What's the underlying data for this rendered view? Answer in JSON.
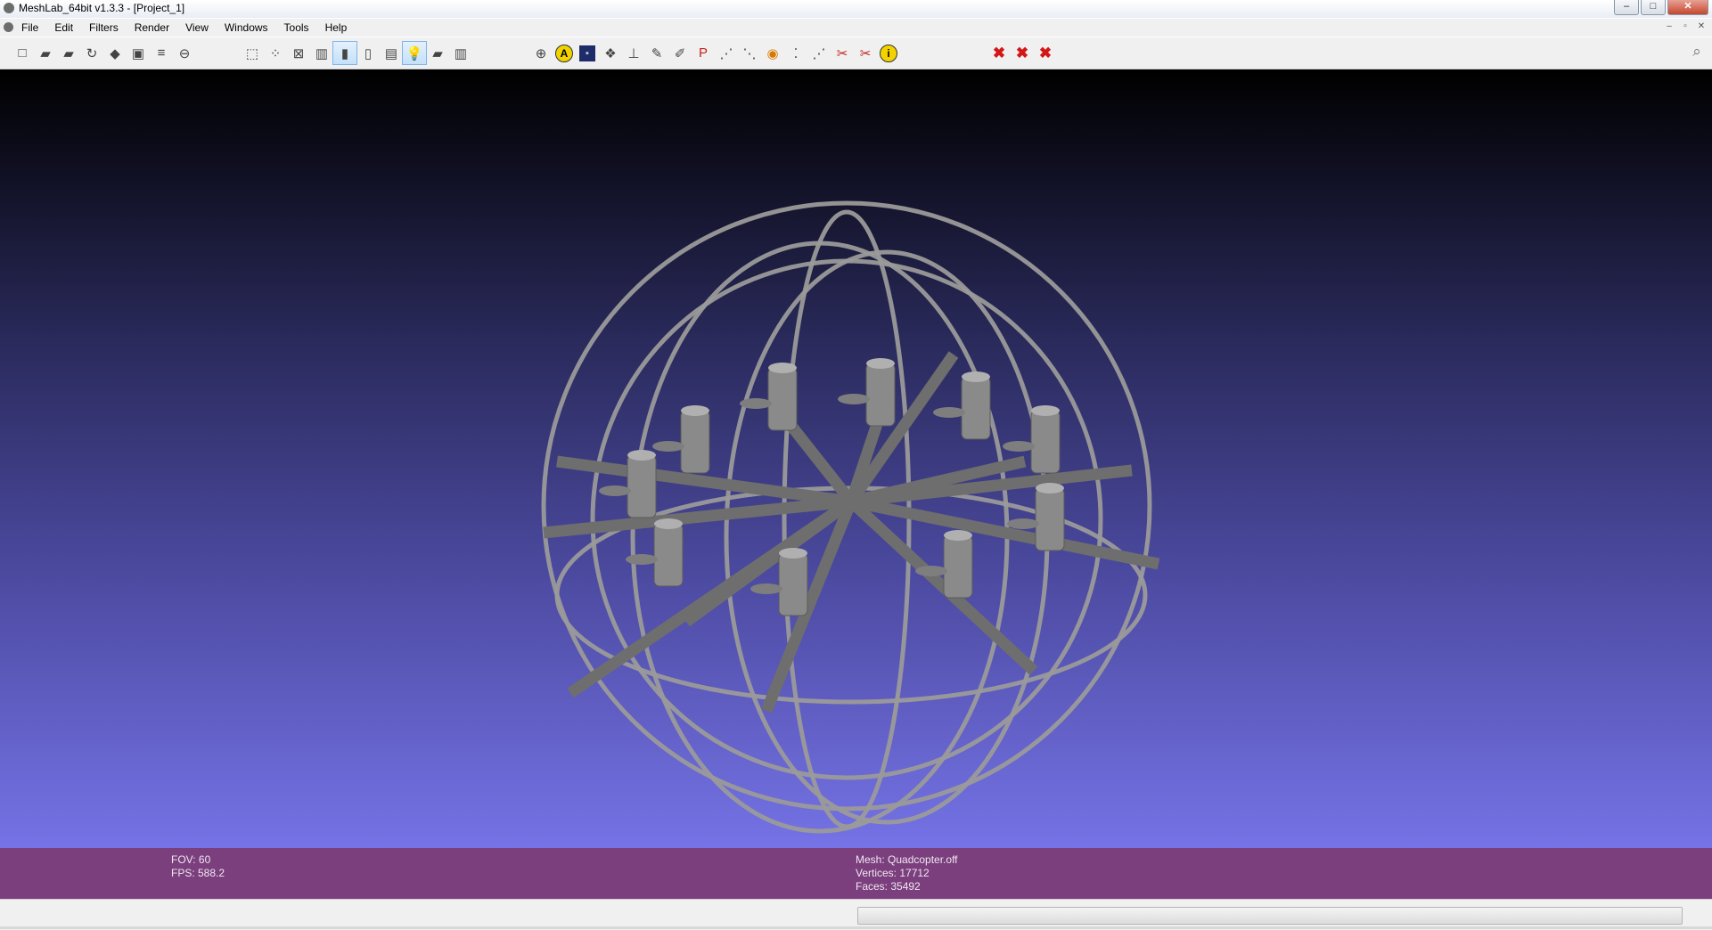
{
  "window": {
    "title": "MeshLab_64bit v1.3.3 - [Project_1]",
    "controls": {
      "minimize": "–",
      "maximize": "□",
      "close": "✕"
    }
  },
  "menu": {
    "items": [
      "File",
      "Edit",
      "Filters",
      "Render",
      "View",
      "Windows",
      "Tools",
      "Help"
    ],
    "mdi_controls": {
      "minimize": "–",
      "restore": "▫",
      "close": "✕"
    }
  },
  "toolbar": {
    "file_group": [
      {
        "name": "new-project",
        "icon": "□"
      },
      {
        "name": "open-project",
        "icon": "▰"
      },
      {
        "name": "import-mesh",
        "icon": "▰"
      },
      {
        "name": "reload",
        "icon": "↻"
      },
      {
        "name": "export-mesh",
        "icon": "◆"
      },
      {
        "name": "snapshot",
        "icon": "▣"
      },
      {
        "name": "layers",
        "icon": "≡"
      },
      {
        "name": "print",
        "icon": "⊖"
      }
    ],
    "render_group": [
      {
        "name": "bounding-box",
        "icon": "⬚",
        "active": false
      },
      {
        "name": "points",
        "icon": "⁘",
        "active": false
      },
      {
        "name": "wireframe",
        "icon": "⊠",
        "active": false
      },
      {
        "name": "flat-lines",
        "icon": "▥",
        "active": false
      },
      {
        "name": "flat",
        "icon": "▮",
        "active": true
      },
      {
        "name": "smooth",
        "icon": "▯",
        "active": false
      },
      {
        "name": "texture",
        "icon": "▤",
        "active": false
      },
      {
        "name": "light",
        "icon": "💡",
        "active": true
      },
      {
        "name": "double-side",
        "icon": "▰",
        "active": false
      },
      {
        "name": "fancy",
        "icon": "▥",
        "active": false
      }
    ],
    "edit_group": [
      {
        "name": "manipulator",
        "icon": "⊕"
      },
      {
        "name": "annotate",
        "icon": "A",
        "style": "y"
      },
      {
        "name": "measure",
        "icon": "▪",
        "style": "dk"
      },
      {
        "name": "texture-param",
        "icon": "❖"
      },
      {
        "name": "align",
        "icon": "⊥"
      },
      {
        "name": "paint",
        "icon": "✎"
      },
      {
        "name": "brush",
        "icon": "✐"
      },
      {
        "name": "pick-points",
        "icon": "P",
        "style": "rd"
      },
      {
        "name": "select-vertex",
        "icon": "⋰"
      },
      {
        "name": "select-face",
        "icon": "⋱"
      },
      {
        "name": "z-paint",
        "icon": "◉",
        "style": "or"
      },
      {
        "name": "reference",
        "icon": "⁚"
      },
      {
        "name": "select-conn",
        "icon": "⋰"
      },
      {
        "name": "delete-vertex",
        "icon": "✂",
        "style": "rd"
      },
      {
        "name": "delete-face",
        "icon": "✂",
        "style": "rd"
      },
      {
        "name": "info",
        "icon": "i",
        "style": "y"
      }
    ],
    "delete_group": [
      {
        "name": "delete-faces",
        "icon": "✖",
        "style": "rx"
      },
      {
        "name": "delete-vertices",
        "icon": "✖",
        "style": "rx"
      },
      {
        "name": "delete-all",
        "icon": "✖",
        "style": "rx"
      }
    ],
    "search_icon": "⌕"
  },
  "viewport": {
    "bg_top": "#000000",
    "bg_bottom": "#7573e6",
    "mesh_color": "#9a9a9a"
  },
  "info": {
    "fov": "FOV: 60",
    "fps": "FPS:   588.2",
    "mesh": "Mesh: Quadcopter.off",
    "vertices": "Vertices: 17712",
    "faces": "Faces: 35492"
  },
  "status": {
    "progress": 0
  }
}
